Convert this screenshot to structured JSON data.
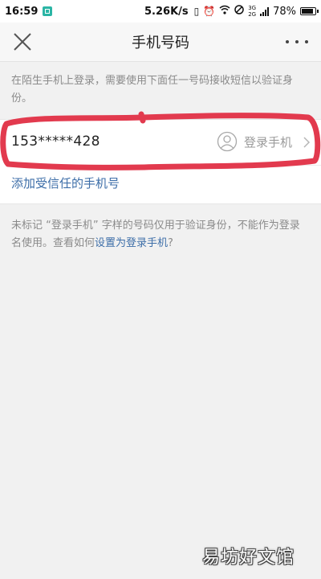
{
  "status_bar": {
    "time": "16:59",
    "net_speed": "5.26K/s",
    "network_types": [
      "3G",
      "2G"
    ],
    "battery": "78%"
  },
  "header": {
    "title": "手机号码",
    "close_icon": "close-icon",
    "more_icon": "more-icon"
  },
  "info_text": "在陌生手机上登录，需要使用下面任一号码接收短信以验证身份。",
  "phone_entry": {
    "number": "153*****428",
    "login_label": "登录手机",
    "icon": "user-icon"
  },
  "add_trusted_label": "添加受信任的手机号",
  "note": {
    "text": "未标记 “登录手机” 字样的号码仅用于验证身份，不能作为登录名使用。查看如何",
    "link": "设置为登录手机",
    "suffix": "?"
  },
  "watermark": "易坊好文馆",
  "colors": {
    "link": "#3d6ea8",
    "annotation_red": "#e23a4e",
    "background": "#f1f1f1"
  }
}
